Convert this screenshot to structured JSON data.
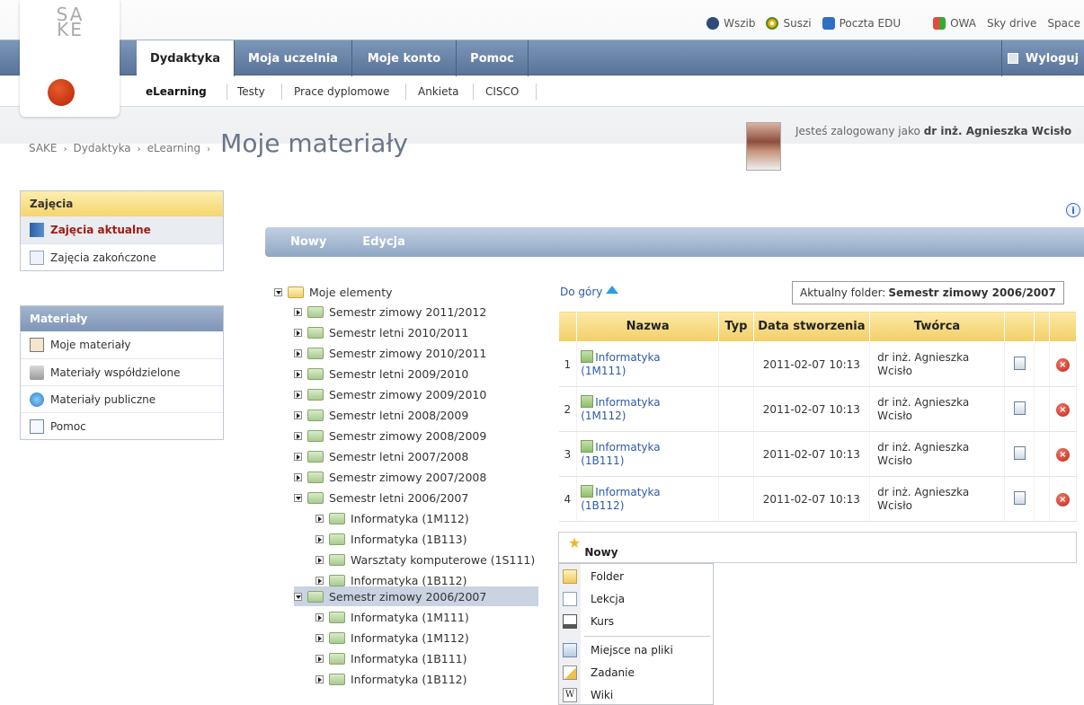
{
  "toplinks": [
    "Wszib",
    "Suszi",
    "Poczta EDU",
    "OWA",
    "Sky drive",
    "Space"
  ],
  "logo_text": "SAKE",
  "mainnav": {
    "tabs": [
      "Dydaktyka",
      "Moja uczelnia",
      "Moje konto",
      "Pomoc"
    ],
    "logout": "Wyloguj"
  },
  "subnav": [
    "eLearning",
    "Testy",
    "Prace dyplomowe",
    "Ankieta",
    "CISCO"
  ],
  "breadcrumb": {
    "items": [
      "SAKE",
      "Dydaktyka",
      "eLearning"
    ],
    "title": "Moje materiały"
  },
  "user": {
    "prefix": "Jesteś zalogowany jako",
    "name": "dr inż. Agnieszka Wcisło"
  },
  "sidebar": {
    "zajecia": {
      "title": "Zajęcia",
      "items": [
        "Zajęcia aktualne",
        "Zajęcia zakończone"
      ]
    },
    "materialy": {
      "title": "Materiały",
      "items": [
        "Moje materiały",
        "Materiały współdzielone",
        "Materiały publiczne",
        "Pomoc"
      ]
    }
  },
  "toolbar": {
    "new": "Nowy",
    "edit": "Edycja"
  },
  "tree": {
    "root": "Moje elementy",
    "nodes": [
      "Semestr zimowy 2011/2012",
      "Semestr letni 2010/2011",
      "Semestr zimowy 2010/2011",
      "Semestr letni 2009/2010",
      "Semestr zimowy 2009/2010",
      "Semestr letni 2008/2009",
      "Semestr zimowy 2008/2009",
      "Semestr letni 2007/2008",
      "Semestr zimowy 2007/2008",
      "Semestr letni 2006/2007",
      "Informatyka (1M112)",
      "Informatyka (1B113)",
      "Warsztaty komputerowe (1S111)",
      "Informatyka (1B112)",
      "Semestr zimowy 2006/2007",
      "Informatyka (1M111)",
      "Informatyka (1M112)",
      "Informatyka (1B111)",
      "Informatyka (1B112)"
    ]
  },
  "up_link": "Do góry",
  "current_folder": {
    "label": "Aktualny folder:",
    "value": "Semestr zimowy 2006/2007"
  },
  "table": {
    "headers": [
      "Nazwa",
      "Typ",
      "Data stworzenia",
      "Twórca"
    ],
    "rows": [
      {
        "num": "1",
        "name1": "Informatyka",
        "name2": "(1M111)",
        "type": "",
        "date": "2011-02-07 10:13",
        "author1": "dr inż. Agnieszka",
        "author2": "Wcisło"
      },
      {
        "num": "2",
        "name1": "Informatyka",
        "name2": "(1M112)",
        "type": "",
        "date": "2011-02-07 10:13",
        "author1": "dr inż. Agnieszka",
        "author2": "Wcisło"
      },
      {
        "num": "3",
        "name1": "Informatyka",
        "name2": "(1B111)",
        "type": "",
        "date": "2011-02-07 10:13",
        "author1": "dr inż. Agnieszka",
        "author2": "Wcisło"
      },
      {
        "num": "4",
        "name1": "Informatyka",
        "name2": "(1B112)",
        "type": "",
        "date": "2011-02-07 10:13",
        "author1": "dr inż. Agnieszka",
        "author2": "Wcisło"
      }
    ]
  },
  "new_panel": {
    "title": "Nowy",
    "items": [
      "Folder",
      "Lekcja",
      "Kurs",
      "Miejsce na pliki",
      "Zadanie",
      "Wiki"
    ]
  }
}
